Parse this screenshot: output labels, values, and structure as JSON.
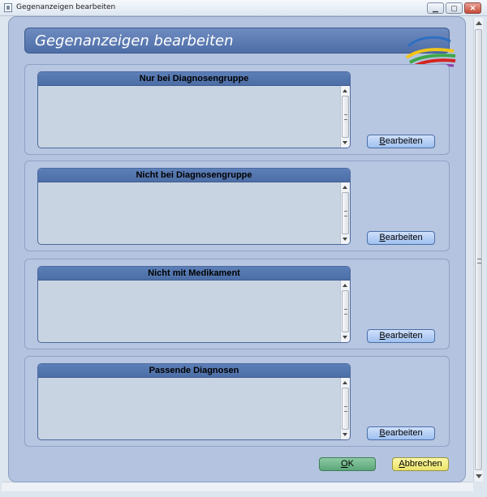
{
  "window": {
    "title": "Gegenanzeigen bearbeiten",
    "min_glyph": "▁",
    "max_glyph": "▢",
    "close_glyph": "✕"
  },
  "header": {
    "title": "Gegenanzeigen bearbeiten",
    "logo_icon": "swoosh-logo-icon",
    "logo_colors": [
      "#2f6fc1",
      "#f3c418",
      "#3ea64a",
      "#d4241f",
      "#8b3fa8"
    ]
  },
  "sections": [
    {
      "title": "Nur bei Diagnosengruppe",
      "items": [],
      "button_mnemonic": "B",
      "button_rest": "earbeiten"
    },
    {
      "title": "Nicht bei Diagnosengruppe",
      "items": [],
      "button_mnemonic": "B",
      "button_rest": "earbeiten"
    },
    {
      "title": "Nicht mit Medikament",
      "items": [],
      "button_mnemonic": "B",
      "button_rest": "earbeiten"
    },
    {
      "title": "Passende Diagnosen",
      "items": [],
      "button_mnemonic": "B",
      "button_rest": "earbeiten"
    }
  ],
  "footer": {
    "ok_mnemonic": "O",
    "ok_rest": "K",
    "cancel_mnemonic": "A",
    "cancel_rest": "bbrechen"
  },
  "colors": {
    "panel": "#b4c3df",
    "header": "#5577b0",
    "ok": "#6fb58a",
    "cancel": "#f2ec86",
    "edit_button": "#b3cff5"
  }
}
